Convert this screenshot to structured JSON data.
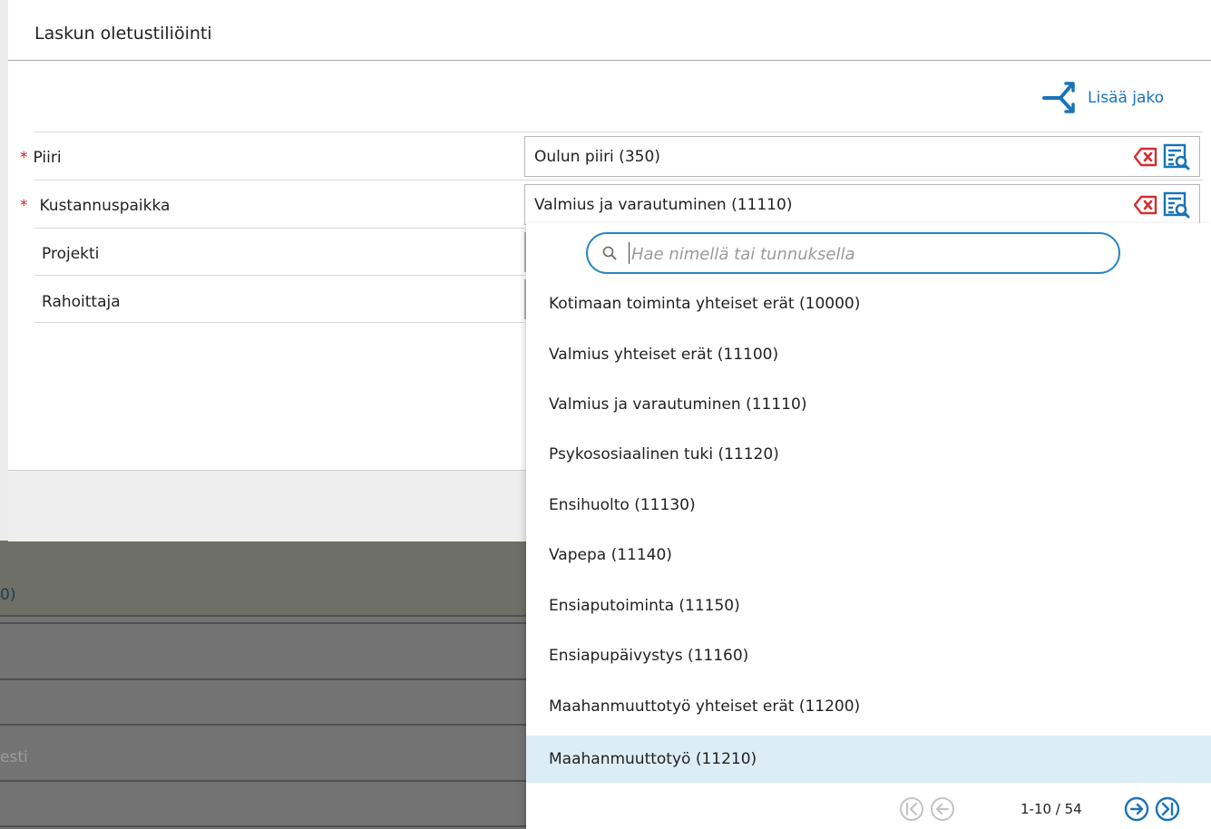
{
  "dialog": {
    "title": "Laskun oletustiliöinti",
    "add_split_label": "Lisää jako"
  },
  "fields": {
    "piiri": {
      "label": "Piiri",
      "required": true,
      "value": "Oulun piiri (350)"
    },
    "kustannuspaikka": {
      "label": "Kustannuspaikka",
      "required": true,
      "value": "Valmius ja varautuminen (11110)"
    },
    "projekti": {
      "label": "Projekti"
    },
    "rahoittaja": {
      "label": "Rahoittaja"
    }
  },
  "required_marker": "*",
  "dropdown": {
    "search_placeholder": "Hae nimellä tai tunnuksella",
    "options": [
      "Kotimaan toiminta yhteiset erät (10000)",
      "Valmius yhteiset erät (11100)",
      "Valmius ja varautuminen (11110)",
      "Psykososiaalinen tuki (11120)",
      "Ensihuolto (11130)",
      "Vapepa (11140)",
      "Ensiaputoiminta (11150)",
      "Ensiapupäivystys (11160)",
      "Maahanmuuttotyö yhteiset erät (11200)",
      "Maahanmuuttotyö (11210)"
    ],
    "highlighted_index": 9,
    "pagination": "1-10 / 54"
  },
  "background": {
    "fragment_1": "0)",
    "fragment_2": "esti"
  },
  "colors": {
    "accent": "#1a73b8",
    "clear_red": "#d32f2f",
    "required_red": "#c62828",
    "highlight": "#dcedf8"
  }
}
